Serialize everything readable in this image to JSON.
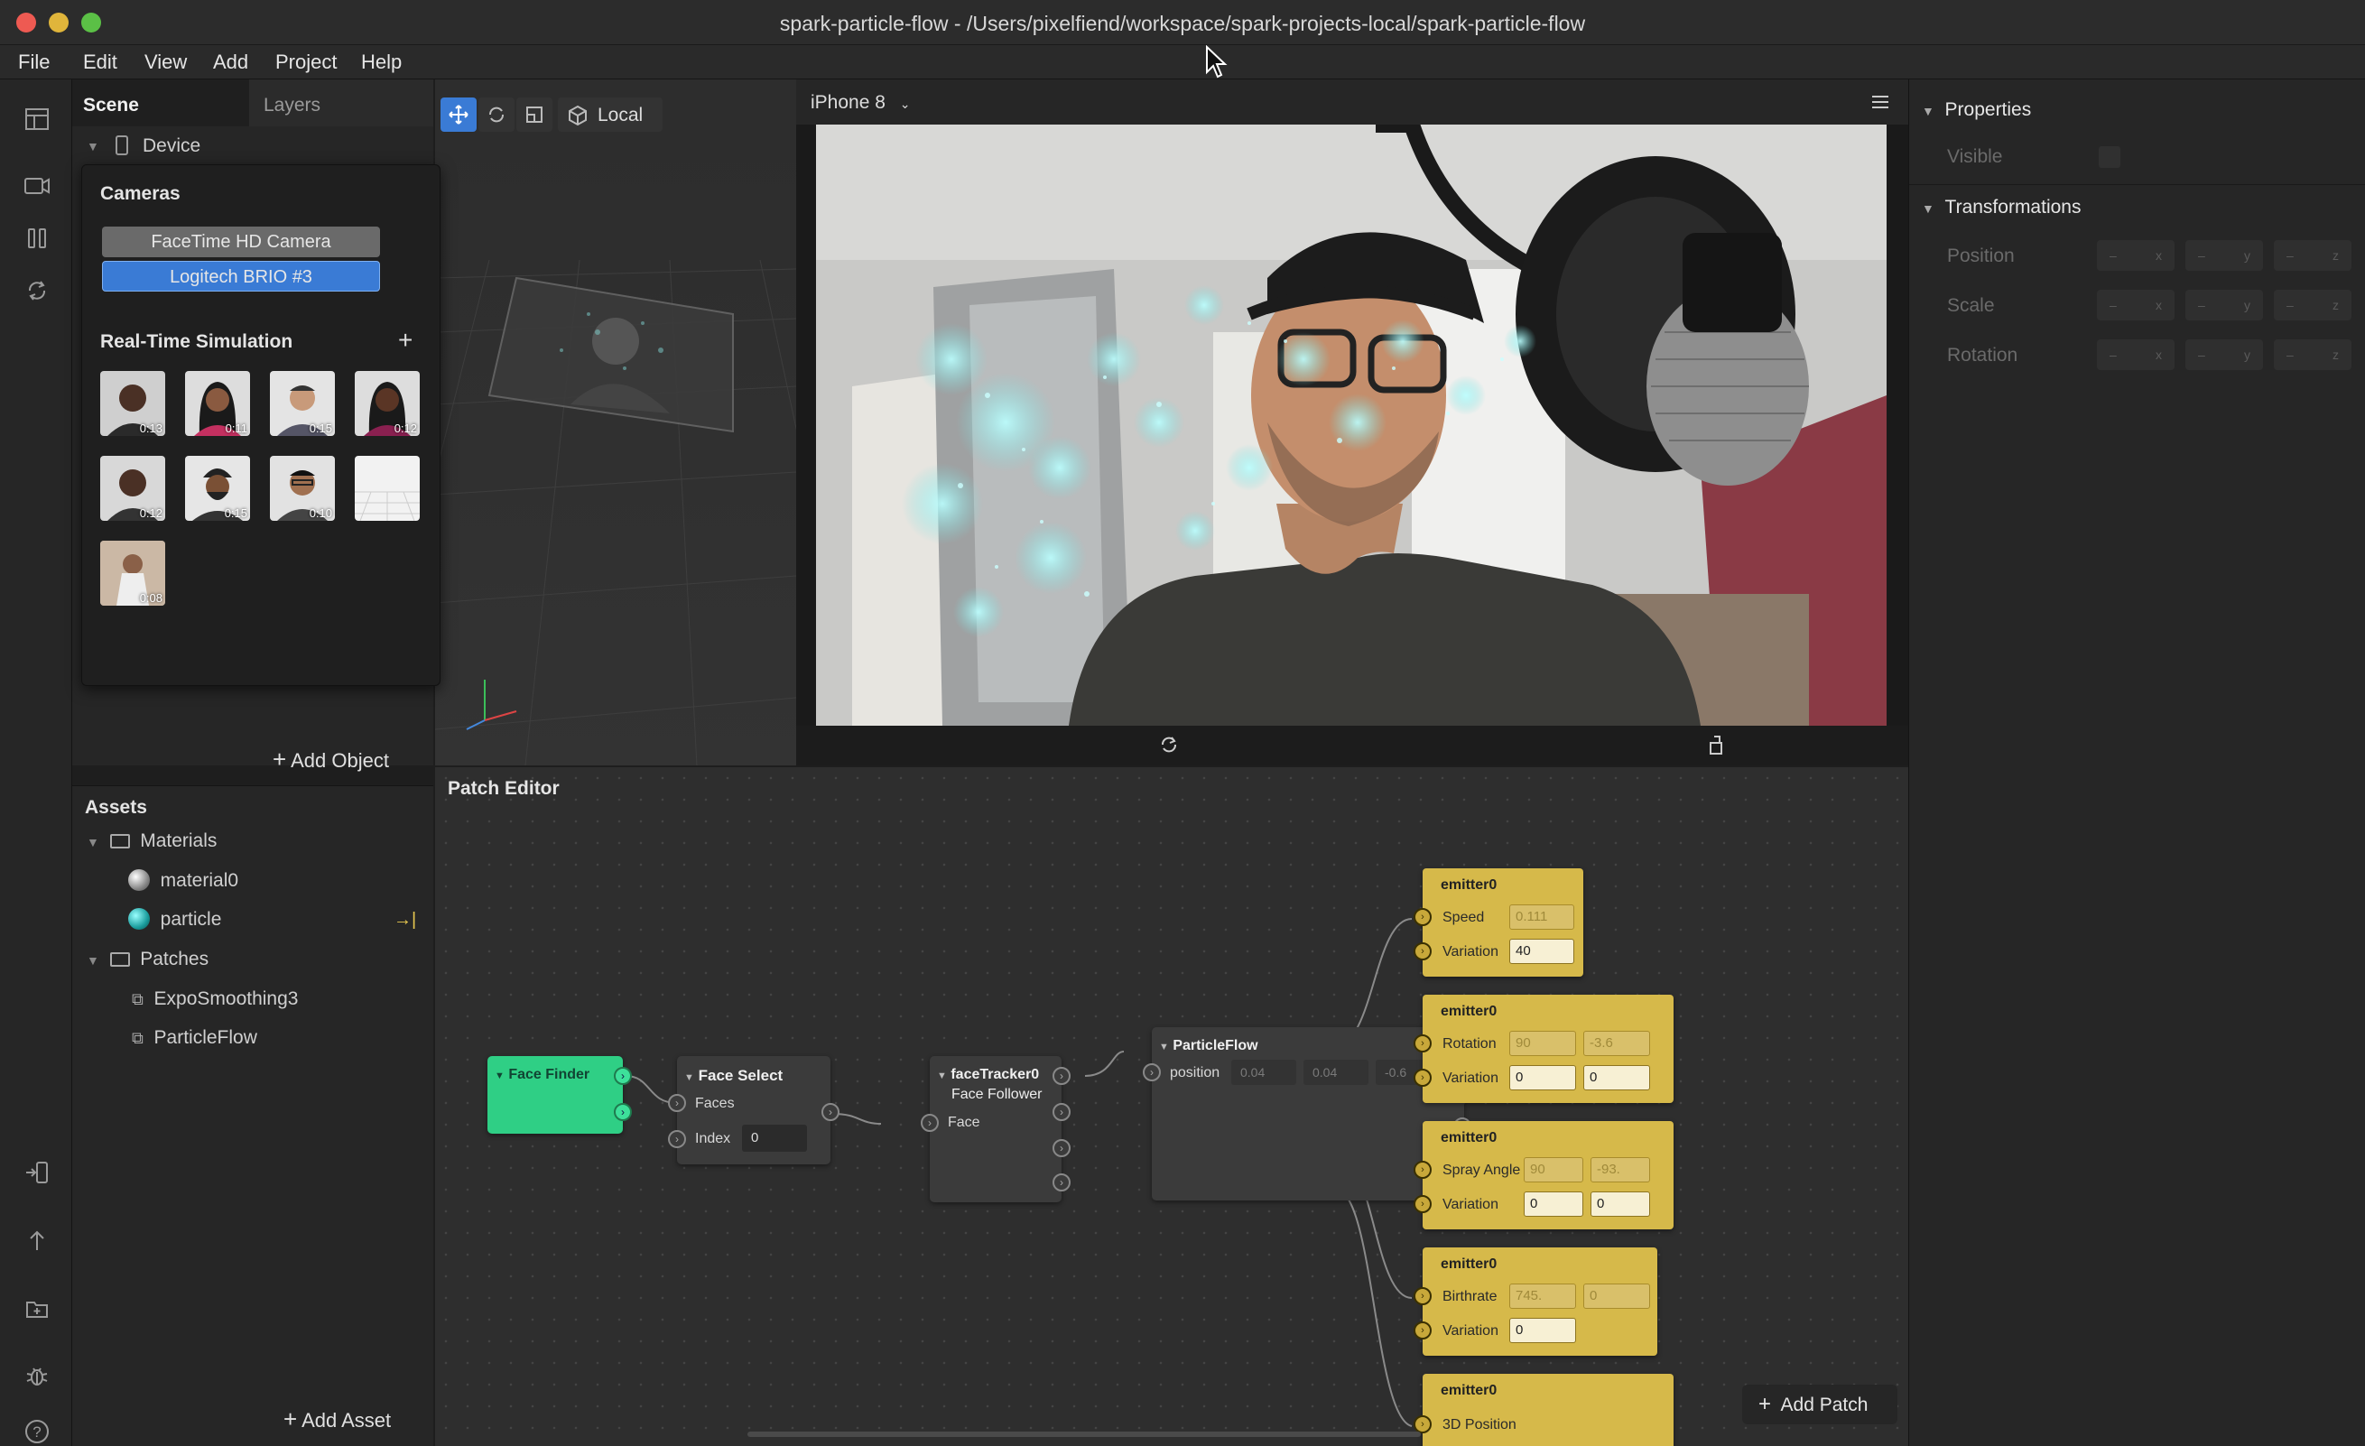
{
  "window": {
    "title": "spark-particle-flow - /Users/pixelfiend/workspace/spark-projects-local/spark-particle-flow"
  },
  "menu": [
    "File",
    "Edit",
    "View",
    "Add",
    "Project",
    "Help"
  ],
  "scene": {
    "tabs": [
      "Scene",
      "Layers"
    ],
    "device_label": "Device",
    "add_object": "Add Object"
  },
  "cameras": {
    "title": "Cameras",
    "items": [
      "FaceTime HD Camera",
      "Logitech BRIO #3"
    ],
    "selected": "Logitech BRIO #3"
  },
  "simulation": {
    "title": "Real-Time Simulation",
    "add_label": "+",
    "durations": [
      "0:13",
      "0:11",
      "0:15",
      "0:12",
      "0:12",
      "0:15",
      "0:10",
      "",
      "0:08"
    ]
  },
  "toolbar": {
    "space_label": "Local"
  },
  "viewport": {
    "device": "iPhone 8"
  },
  "assets": {
    "title": "Assets",
    "materials_label": "Materials",
    "materials": [
      "material0",
      "particle"
    ],
    "patches_label": "Patches",
    "patches": [
      "ExpoSmoothing3",
      "ParticleFlow"
    ],
    "add_asset": "Add Asset"
  },
  "properties": {
    "title": "Properties",
    "visible_label": "Visible",
    "transformations_title": "Transformations",
    "rows": [
      "Position",
      "Scale",
      "Rotation"
    ],
    "axes": [
      "x",
      "y",
      "z"
    ],
    "empty_value": "–"
  },
  "patch_editor": {
    "title": "Patch Editor",
    "face_finder": "Face Finder",
    "face_select": {
      "title": "Face Select",
      "faces": "Faces",
      "index_label": "Index",
      "index_value": "0"
    },
    "face_tracker": {
      "title": "faceTracker0",
      "subtitle": "Face Follower",
      "face": "Face"
    },
    "particle_flow": {
      "title": "ParticleFlow",
      "position": "position",
      "x": "0.04",
      "y": "0.04",
      "z": "-0.6"
    },
    "emitters": [
      {
        "title": "emitter0",
        "row1": "Speed",
        "row1_v1": "0.111",
        "row2": "Variation",
        "row2_v1": "40"
      },
      {
        "title": "emitter0",
        "row1": "Rotation",
        "row1_v1": "90",
        "row1_v2": "-3.6",
        "row2": "Variation",
        "row2_v1": "0",
        "row2_v2": "0"
      },
      {
        "title": "emitter0",
        "row1": "Spray Angle",
        "row1_v1": "90",
        "row1_v2": "-93.",
        "row2": "Variation",
        "row2_v1": "0",
        "row2_v2": "0"
      },
      {
        "title": "emitter0",
        "row1": "Birthrate",
        "row1_v1": "745.",
        "row1_v2": "0",
        "row2": "Variation",
        "row2_v1": "0"
      },
      {
        "title": "emitter0",
        "row1": "3D Position"
      }
    ],
    "add_patch": "Add Patch"
  }
}
